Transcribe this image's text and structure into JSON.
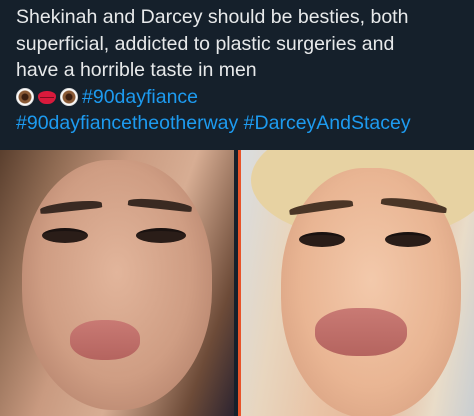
{
  "tweet": {
    "line1": "Shekinah and Darcey should be besties, both",
    "line2": "superficial, addicted to plastic surgeries and",
    "line3": "have a horrible taste in men",
    "hashtag1": "#90dayfiance",
    "hashtag2": "#90dayfiancetheotherway",
    "hashtag3": "#DarceyAndStacey",
    "emojis": [
      "eye-emoji",
      "lips-emoji",
      "eye-emoji"
    ]
  },
  "colors": {
    "background": "#15202b",
    "text": "#e7e9ea",
    "hashtag": "#1d9bf0",
    "divider": "#e8542a"
  }
}
